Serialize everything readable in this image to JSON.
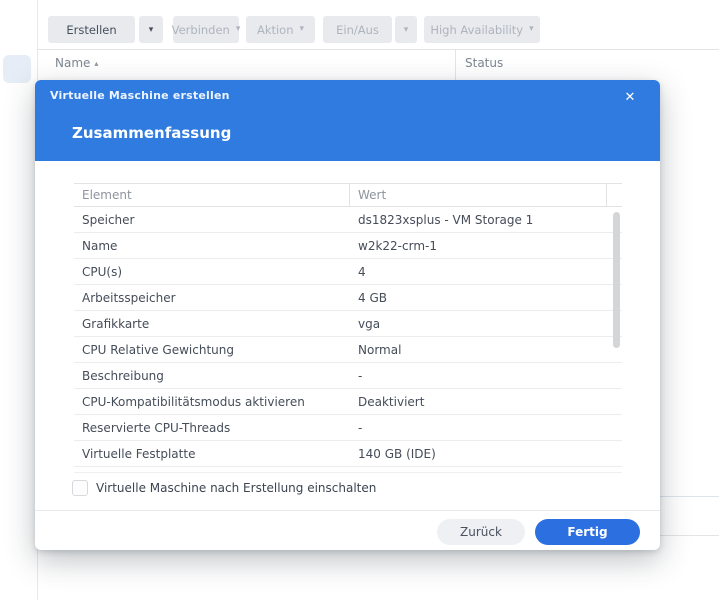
{
  "colors": {
    "header_blue": "#2f7be0",
    "finish_button_blue": "#2c6fe1",
    "toolbar_button_bg": "#e8eaee",
    "disabled_text": "#aeb4be"
  },
  "toolbar": {
    "buttons": [
      {
        "label": "Erstellen",
        "enabled": true,
        "split": true
      },
      {
        "label": "Verbinden",
        "enabled": false,
        "split": false
      },
      {
        "label": "Aktion",
        "enabled": false,
        "split": false
      },
      {
        "label": "Ein/Aus",
        "enabled": false,
        "split": true
      },
      {
        "label": "High Availability",
        "enabled": false,
        "split": false
      }
    ],
    "dropdown_arrow": "▾"
  },
  "background_table": {
    "name_header": "Name",
    "status_header": "Status",
    "sort_icon": "▴"
  },
  "dialog": {
    "title": "Virtuelle Maschine erstellen",
    "close_icon": "✕",
    "section_title": "Zusammenfassung",
    "table": {
      "headers": [
        "Element",
        "Wert"
      ],
      "rows": [
        [
          "Speicher",
          "ds1823xsplus - VM Storage 1"
        ],
        [
          "Name",
          "w2k22-crm-1"
        ],
        [
          "CPU(s)",
          "4"
        ],
        [
          "Arbeitsspeicher",
          "4 GB"
        ],
        [
          "Grafikkarte",
          "vga"
        ],
        [
          "CPU Relative Gewichtung",
          "Normal"
        ],
        [
          "Beschreibung",
          "-"
        ],
        [
          "CPU-Kompatibilitätsmodus aktivieren",
          "Deaktiviert"
        ],
        [
          "Reservierte CPU-Threads",
          "-"
        ],
        [
          "Virtuelle Festplatte",
          "140 GB (IDE)"
        ]
      ]
    },
    "checkbox": {
      "label": "Virtuelle Maschine nach Erstellung einschalten",
      "checked": false
    },
    "buttons": {
      "back": "Zurück",
      "finish": "Fertig"
    }
  }
}
